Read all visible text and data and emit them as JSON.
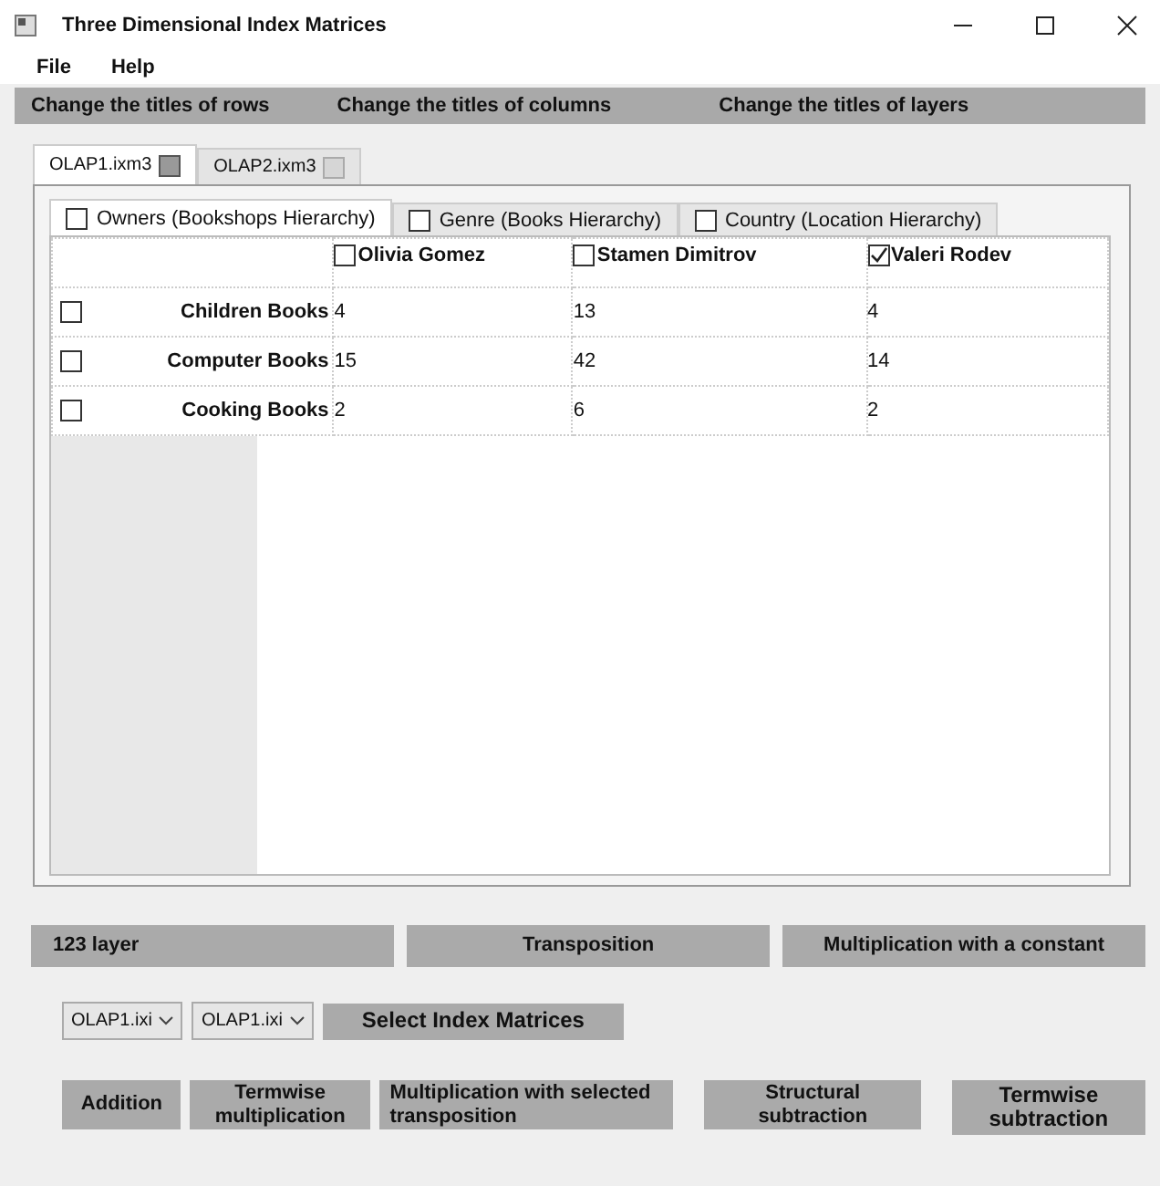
{
  "window": {
    "title": "Three Dimensional Index Matrices"
  },
  "menu": [
    "File",
    "Help"
  ],
  "toolbar": [
    "Change the titles of rows",
    "Change the titles of columns",
    "Change the titles of layers"
  ],
  "file_tabs": [
    {
      "label": "OLAP1.ixm3",
      "selected": true
    },
    {
      "label": "OLAP2.ixm3",
      "selected": false
    }
  ],
  "hierarchy_tabs": [
    {
      "label": "Owners (Bookshops Hierarchy)",
      "checked": false,
      "selected": true
    },
    {
      "label": "Genre (Books Hierarchy)",
      "checked": false,
      "selected": false
    },
    {
      "label": "Country (Location Hierarchy)",
      "checked": false,
      "selected": false
    }
  ],
  "table": {
    "columns": [
      {
        "label": "Olivia Gomez",
        "checked": false
      },
      {
        "label": "Stamen Dimitrov",
        "checked": false
      },
      {
        "label": "Valeri Rodev",
        "checked": true
      }
    ],
    "rows": [
      {
        "label": "Children Books",
        "checked": false,
        "cells": [
          "4",
          "13",
          "4"
        ]
      },
      {
        "label": "Computer Books",
        "checked": false,
        "cells": [
          "15",
          "42",
          "14"
        ]
      },
      {
        "label": "Cooking Books",
        "checked": false,
        "cells": [
          "2",
          "6",
          "2"
        ]
      }
    ]
  },
  "actions": [
    "123 layer",
    "Transposition",
    "Multiplication with a constant"
  ],
  "selectors": [
    {
      "value": "OLAP1.ixi"
    },
    {
      "value": "OLAP1.ixi"
    }
  ],
  "select_button": "Select Index Matrices",
  "operations": [
    "Addition",
    "Termwise multiplication",
    "Multiplication with selected transposition",
    "Structural subtraction",
    "Termwise subtraction"
  ]
}
